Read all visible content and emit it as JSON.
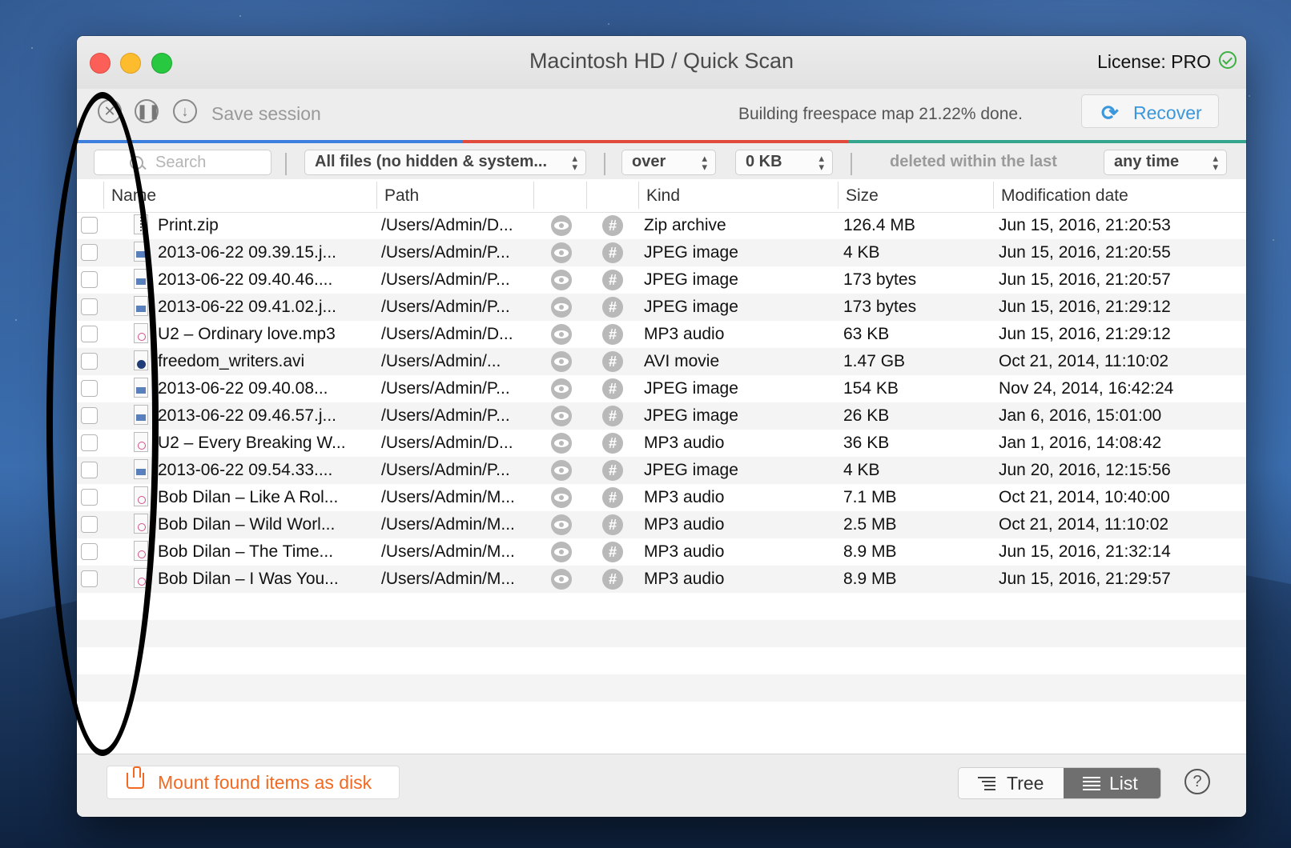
{
  "window": {
    "title": "Macintosh HD / Quick Scan",
    "license": "License: PRO"
  },
  "toolbar": {
    "save_session": "Save session",
    "status": "Building freespace map 21.22% done.",
    "recover_label": "Recover",
    "progress_segments_colors": [
      "#3d7fdc",
      "#e04b3c",
      "#36a58e"
    ]
  },
  "filters": {
    "search_placeholder": "Search",
    "file_type": "All files (no hidden & system...",
    "size_op": "over",
    "size_value": "0 KB",
    "deleted_label": "deleted within the last",
    "time_range": "any time"
  },
  "table": {
    "columns": [
      "Name",
      "Path",
      "Kind",
      "Size",
      "Modification date"
    ],
    "rows": [
      {
        "name": "Print.zip",
        "path": "/Users/Admin/D...",
        "kind": "Zip archive",
        "size": "126.4 MB",
        "date": "Jun 15, 2016, 21:20:53",
        "icon": "zip"
      },
      {
        "name": "2013-06-22 09.39.15.j...",
        "path": "/Users/Admin/P...",
        "kind": "JPEG image",
        "size": "4 KB",
        "date": "Jun 15, 2016, 21:20:55",
        "icon": "img"
      },
      {
        "name": "2013-06-22 09.40.46....",
        "path": "/Users/Admin/P...",
        "kind": "JPEG image",
        "size": "173 bytes",
        "date": "Jun 15, 2016, 21:20:57",
        "icon": "img"
      },
      {
        "name": "2013-06-22 09.41.02.j...",
        "path": "/Users/Admin/P...",
        "kind": "JPEG image",
        "size": "173 bytes",
        "date": "Jun 15, 2016, 21:29:12",
        "icon": "img"
      },
      {
        "name": "U2 – Ordinary love.mp3",
        "path": "/Users/Admin/D...",
        "kind": "MP3 audio",
        "size": "63 KB",
        "date": "Jun 15, 2016, 21:29:12",
        "icon": "aud"
      },
      {
        "name": "freedom_writers.avi",
        "path": "/Users/Admin/...",
        "kind": "AVI movie",
        "size": "1.47 GB",
        "date": "Oct 21, 2014, 11:10:02",
        "icon": "vid"
      },
      {
        "name": "2013-06-22 09.40.08...",
        "path": "/Users/Admin/P...",
        "kind": "JPEG image",
        "size": "154 KB",
        "date": "Nov 24, 2014, 16:42:24",
        "icon": "img"
      },
      {
        "name": "2013-06-22 09.46.57.j...",
        "path": "/Users/Admin/P...",
        "kind": "JPEG image",
        "size": "26 KB",
        "date": "Jan 6, 2016, 15:01:00",
        "icon": "img"
      },
      {
        "name": "U2 – Every Breaking W...",
        "path": "/Users/Admin/D...",
        "kind": "MP3 audio",
        "size": "36 KB",
        "date": "Jan 1, 2016, 14:08:42",
        "icon": "aud"
      },
      {
        "name": "2013-06-22 09.54.33....",
        "path": "/Users/Admin/P...",
        "kind": "JPEG image",
        "size": "4 KB",
        "date": "Jun 20, 2016, 12:15:56",
        "icon": "img"
      },
      {
        "name": "Bob Dilan – Like A Rol...",
        "path": "/Users/Admin/M...",
        "kind": "MP3 audio",
        "size": "7.1 MB",
        "date": "Oct 21, 2014, 10:40:00",
        "icon": "aud"
      },
      {
        "name": "Bob Dilan – Wild Worl...",
        "path": "/Users/Admin/M...",
        "kind": "MP3 audio",
        "size": "2.5 MB",
        "date": "Oct 21, 2014, 11:10:02",
        "icon": "aud"
      },
      {
        "name": "Bob Dilan – The Time...",
        "path": "/Users/Admin/M...",
        "kind": "MP3 audio",
        "size": "8.9 MB",
        "date": "Jun 15, 2016, 21:32:14",
        "icon": "aud"
      },
      {
        "name": "Bob Dilan – I Was You...",
        "path": "/Users/Admin/M...",
        "kind": "MP3 audio",
        "size": "8.9 MB",
        "date": "Jun 15, 2016, 21:29:57",
        "icon": "aud"
      }
    ]
  },
  "bottom": {
    "mount_label": "Mount found items as disk",
    "tree_label": "Tree",
    "list_label": "List",
    "help_label": "?"
  }
}
